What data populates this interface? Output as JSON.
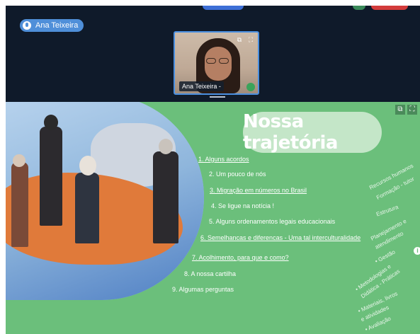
{
  "presenter": {
    "name": "Ana Teixeira"
  },
  "video_tile": {
    "name": "Ana Teixeira -"
  },
  "slide": {
    "title": "Nossa trajetória",
    "agenda": [
      "1.  Alguns acordos",
      "2. Um pouco de nós",
      "3.  Migração em números no Brasil",
      "4.  Se ligue na notícia !",
      "5.  Alguns ordenamentos legais educacionais",
      "6.  Semelhancas e diferencas - Uma tal interculturalidade",
      "7.  Acolhimento, para que e como?",
      "8.  A nossa cartilha",
      "9.  Algumas perguntas"
    ],
    "side_notes": [
      "Recursos humanos",
      "Formação - tutor",
      "Estrutura",
      "Planejamento e",
      "atendimento",
      "• Gestão",
      "• Metodologias e",
      "Didática - Práticas",
      "• Materiais, livros",
      "e atividades",
      "• Avaliação"
    ]
  },
  "icons": {
    "mic": "microphone-icon",
    "popout": "popout-icon",
    "fullscreen": "fullscreen-icon",
    "info": "info-icon"
  },
  "colors": {
    "topbar": "#0f1a2a",
    "slide_bg": "#6bbf7b",
    "accent_blue": "#4f8fd9",
    "title_pill": "#c4e6c8"
  }
}
